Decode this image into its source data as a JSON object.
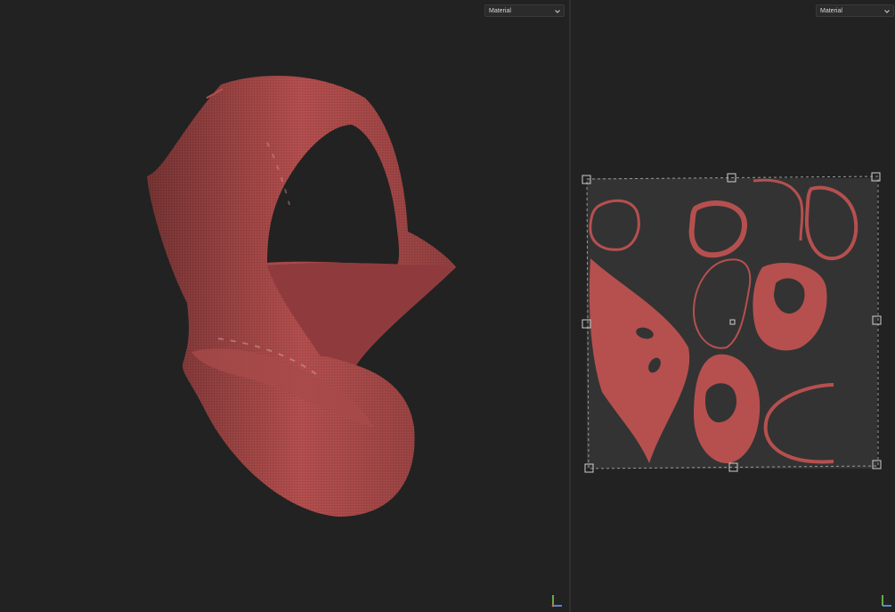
{
  "viewports": {
    "model": {
      "shading_mode": "Material"
    },
    "uv": {
      "shading_mode": "Material"
    }
  },
  "colors": {
    "background": "#222222",
    "uv_tile": "#333333",
    "fabric": "#b5504f",
    "fabric_dark": "#7e2f31",
    "hole": "#1f1f1f",
    "axis_x": "#6ea6ff",
    "axis_y": "#7ed957"
  },
  "icons": {
    "dropdown_chevron": "chevron-down-icon",
    "axis_gizmo": "axis-gizmo-icon"
  }
}
